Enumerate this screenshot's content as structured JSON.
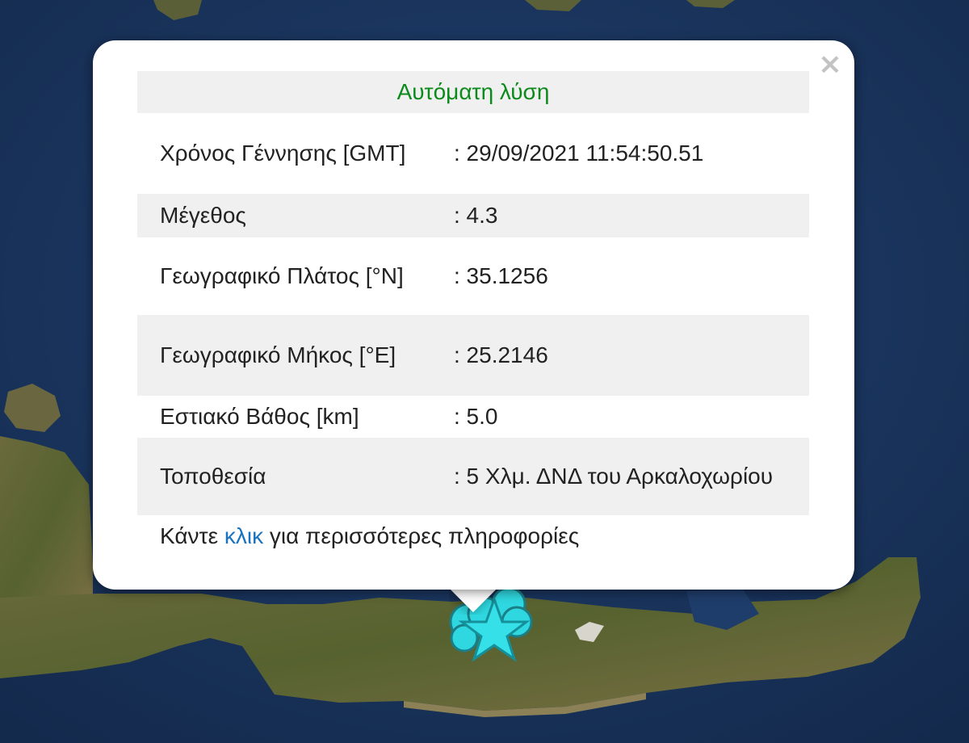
{
  "popup": {
    "header": "Αυτόματη λύση",
    "close_glyph": "×",
    "rows": [
      {
        "label": "Χρόνος Γέννησης [GMT]",
        "value": ": 29/09/2021 11:54:50.51"
      },
      {
        "label": "Μέγεθος",
        "value": ": 4.3"
      },
      {
        "label": "Γεωγραφικό Πλάτος [°N]",
        "value": ": 35.1256"
      },
      {
        "label": "Γεωγραφικό Μήκος [°E]",
        "value": ": 25.2146"
      },
      {
        "label": "Εστιακό Βάθος [km]",
        "value": ": 5.0"
      },
      {
        "label": "Τοποθεσία",
        "value": ": 5 Χλμ. ΔΝΔ του Αρκαλοχωρίου"
      }
    ],
    "footer": {
      "before": "Κάντε ",
      "link": "κλικ",
      "after": " για περισσότερες πληροφορίες"
    }
  },
  "map": {
    "sea_color": "#1b3560",
    "land_color": "#4f5d2f",
    "marker_color": "#2fd8e0",
    "marker_icon": "star-icon"
  }
}
